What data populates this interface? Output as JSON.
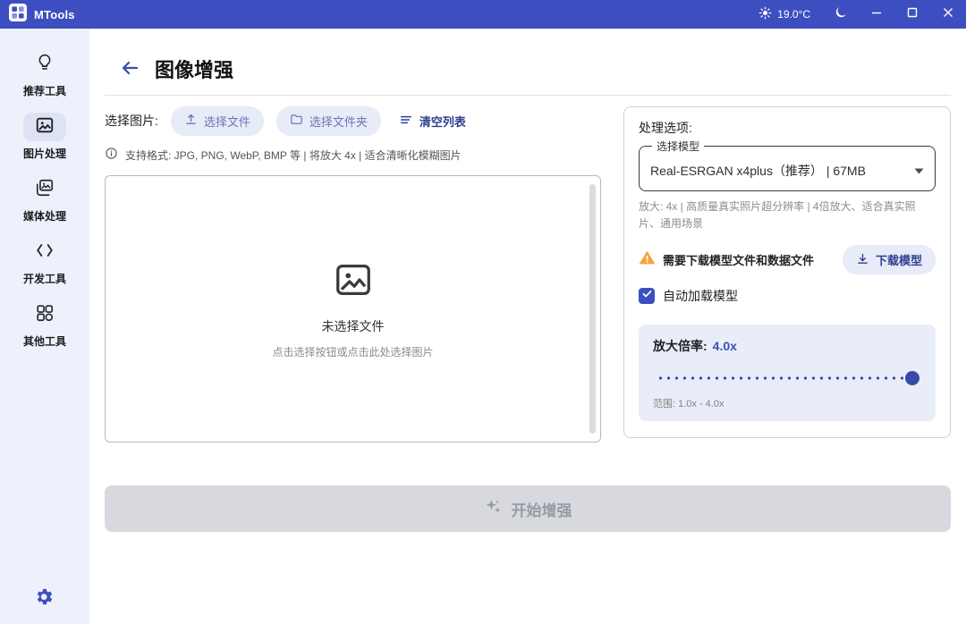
{
  "titlebar": {
    "app_name": "MTools",
    "temperature": "19.0°C"
  },
  "sidebar": {
    "items": [
      {
        "label": "推荐工具",
        "icon": "lightbulb-icon",
        "active": false
      },
      {
        "label": "图片处理",
        "icon": "image-icon",
        "active": true
      },
      {
        "label": "媒体处理",
        "icon": "media-icon",
        "active": false
      },
      {
        "label": "开发工具",
        "icon": "dev-tools-icon",
        "active": false
      },
      {
        "label": "其他工具",
        "icon": "other-tools-icon",
        "active": false
      }
    ]
  },
  "page": {
    "title": "图像增强"
  },
  "file_section": {
    "label": "选择图片:",
    "buttons": {
      "select_file": "选择文件",
      "select_folder": "选择文件夹",
      "clear_list": "清空列表"
    },
    "format_hint": "支持格式: JPG, PNG, WebP, BMP 等 | 将放大 4x | 适合清晰化模糊图片",
    "empty_state": {
      "title": "未选择文件",
      "subtitle": "点击选择按钮或点击此处选择图片"
    }
  },
  "options": {
    "title": "处理选项:",
    "model_group": "选择模型",
    "model_selected": "Real-ESRGAN x4plus（推荐）  |  67MB",
    "model_description": "放大: 4x | 高质量真实照片超分辨率 | 4倍放大、适合真实照片、通用场景",
    "download_warning": "需要下载模型文件和数据文件",
    "download_button": "下载模型",
    "autoload_label": "自动加载模型",
    "autoload_checked": true,
    "scale": {
      "label": "放大倍率:",
      "value": "4.0x",
      "range": "范围: 1.0x - 4.0x",
      "min": "1.0x",
      "max": "4.0x"
    }
  },
  "action": {
    "start_label": "开始增强",
    "enabled": false
  },
  "icons": {
    "app-logo-icon": "four-square grid",
    "sun-icon": "☀",
    "moon-icon": "🌙",
    "minimize-icon": "—",
    "maximize-icon": "□",
    "close-icon": "✕",
    "back-arrow-icon": "←",
    "upload-icon": "⬆",
    "folder-icon": "📁",
    "list-icon": "≡",
    "info-icon": "ⓘ",
    "image-placeholder-icon": "🖼",
    "warning-icon": "⚠",
    "download-icon": "⬇",
    "caret-down-icon": "▼",
    "checkmark-icon": "✓",
    "sparkles-icon": "✦",
    "gear-icon": "⚙"
  },
  "colors": {
    "titlebar": "#3d4fc0",
    "accent": "#3f51b5",
    "warning": "#f5a53c",
    "pill_button_bg": "#e8ebf8",
    "scale_card_bg": "#e9edf9",
    "disabled_button_bg": "#d7d9df"
  }
}
